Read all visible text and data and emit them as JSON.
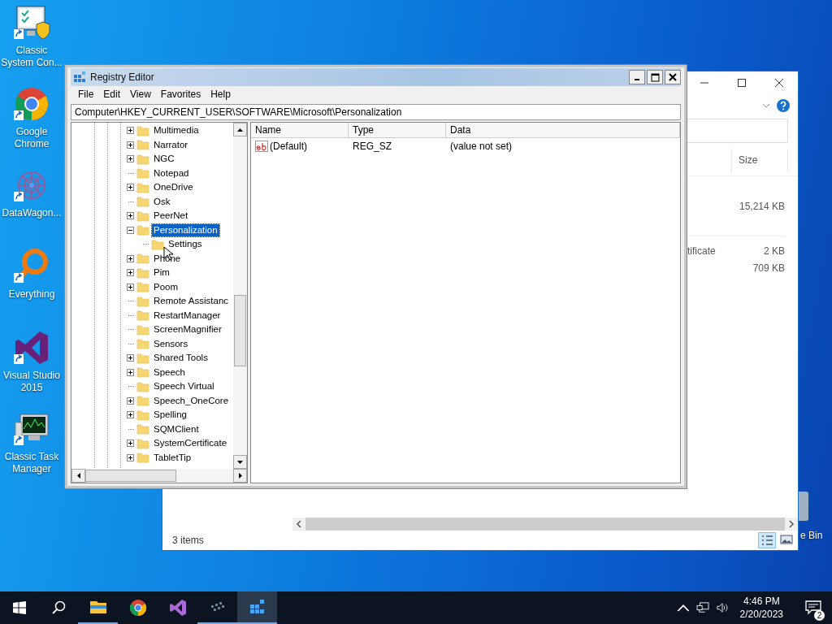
{
  "desktop_icons": [
    {
      "label": "Classic System Con...",
      "kind": "control-panel"
    },
    {
      "label": "Google Chrome",
      "kind": "chrome"
    },
    {
      "label": "DataWagon...",
      "kind": "network"
    },
    {
      "label": "Everything",
      "kind": "magnifier"
    },
    {
      "label": "Visual Studio 2015",
      "kind": "visual-studio"
    },
    {
      "label": "Classic Task Manager",
      "kind": "task-manager"
    }
  ],
  "explorer": {
    "size_header": "Size",
    "rows": [
      {
        "name": "",
        "size": "15,214 KB"
      },
      {
        "name": "tificate",
        "size": "2 KB"
      },
      {
        "name": "",
        "size": "709 KB"
      }
    ],
    "status": "3 items"
  },
  "recycle_bin": {
    "label": "e Bin"
  },
  "registry_editor": {
    "title": "Registry Editor",
    "menu": [
      "File",
      "Edit",
      "View",
      "Favorites",
      "Help"
    ],
    "address": "Computer\\HKEY_CURRENT_USER\\SOFTWARE\\Microsoft\\Personalization",
    "tree": [
      {
        "name": "Multimedia",
        "has_children": true,
        "expanded": false,
        "selected": false
      },
      {
        "name": "Narrator",
        "has_children": true,
        "expanded": false,
        "selected": false
      },
      {
        "name": "NGC",
        "has_children": true,
        "expanded": false,
        "selected": false
      },
      {
        "name": "Notepad",
        "has_children": false,
        "selected": false
      },
      {
        "name": "OneDrive",
        "has_children": true,
        "expanded": false,
        "selected": false
      },
      {
        "name": "Osk",
        "has_children": false,
        "selected": false
      },
      {
        "name": "PeerNet",
        "has_children": true,
        "expanded": false,
        "selected": false
      },
      {
        "name": "Personalization",
        "has_children": true,
        "expanded": true,
        "selected": true,
        "children": [
          {
            "name": "Settings",
            "has_children": false,
            "selected": false
          }
        ]
      },
      {
        "name": "Phone",
        "has_children": true,
        "expanded": false,
        "selected": false
      },
      {
        "name": "Pim",
        "has_children": true,
        "expanded": false,
        "selected": false
      },
      {
        "name": "Poom",
        "has_children": true,
        "expanded": false,
        "selected": false
      },
      {
        "name": "Remote Assistanc",
        "has_children": false,
        "selected": false
      },
      {
        "name": "RestartManager",
        "has_children": false,
        "selected": false
      },
      {
        "name": "ScreenMagnifier",
        "has_children": false,
        "selected": false
      },
      {
        "name": "Sensors",
        "has_children": false,
        "selected": false
      },
      {
        "name": "Shared Tools",
        "has_children": true,
        "expanded": false,
        "selected": false
      },
      {
        "name": "Speech",
        "has_children": true,
        "expanded": false,
        "selected": false
      },
      {
        "name": "Speech Virtual",
        "has_children": false,
        "selected": false
      },
      {
        "name": "Speech_OneCore",
        "has_children": true,
        "expanded": false,
        "selected": false
      },
      {
        "name": "Spelling",
        "has_children": true,
        "expanded": false,
        "selected": false
      },
      {
        "name": "SQMClient",
        "has_children": false,
        "selected": false
      },
      {
        "name": "SystemCertificate",
        "has_children": true,
        "expanded": false,
        "selected": false
      },
      {
        "name": "TabletTip",
        "has_children": true,
        "expanded": false,
        "selected": false
      }
    ],
    "columns": [
      "Name",
      "Type",
      "Data"
    ],
    "values": [
      {
        "name": "(Default)",
        "type": "REG_SZ",
        "data": "(value not set)"
      }
    ]
  },
  "taskbar": {
    "apps": [
      {
        "kind": "file-explorer",
        "running": true,
        "active": false
      },
      {
        "kind": "chrome",
        "running": false,
        "active": false
      },
      {
        "kind": "visual-studio",
        "running": false,
        "active": false
      },
      {
        "kind": "dots",
        "running": true,
        "active": false
      },
      {
        "kind": "registry",
        "running": true,
        "active": true
      }
    ],
    "time": "4:46 PM",
    "date": "2/20/2023",
    "notifications": "2"
  }
}
